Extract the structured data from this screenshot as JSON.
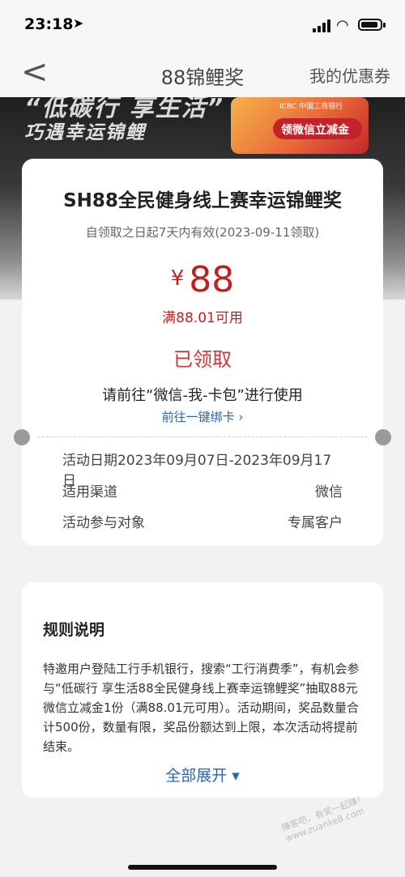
{
  "status_bar": {
    "time": "23:18"
  },
  "nav": {
    "back_glyph": "<",
    "title": "88锦鲤奖",
    "right_link": "我的优惠券"
  },
  "banner": {
    "line1": "“低碳行 享生活”",
    "line2": "巧遇幸运锦鲤",
    "promo_bank": "ICBC 中国工商银行",
    "promo_label": "领微信立减金"
  },
  "coupon": {
    "title": "SH88全民健身线上赛幸运锦鲤奖",
    "validity": "自领取之日起7天内有效(2023-09-11领取)",
    "currency": "¥",
    "amount": "88",
    "min_spend": "满88.01可用",
    "status": "已领取",
    "usage_hint": "请前往“微信-我-卡包”进行使用",
    "bind_link": "前往一键绑卡 ›",
    "details": [
      {
        "label": "活动日期2023年09月07日-2023年09月17日",
        "value": ""
      },
      {
        "label": "适用渠道",
        "value": "微信"
      },
      {
        "label": "活动参与对象",
        "value": "专属客户"
      }
    ]
  },
  "rules": {
    "title": "规则说明",
    "text": "特邀用户登陆工行手机银行，搜索“工行消费季”，有机会参与“低碳行 享生活88全民健身线上赛幸运锦鲤奖”抽取88元微信立减金1份（满88.01元可用）。活动期间，奖品数量合计500份，数量有限，奖品份额达到上限，本次活动将提前结束。",
    "expand_label": "全部展开 ▾"
  },
  "watermark": "赚客吧，有奖一起赚！ www.zuanke8.com"
}
